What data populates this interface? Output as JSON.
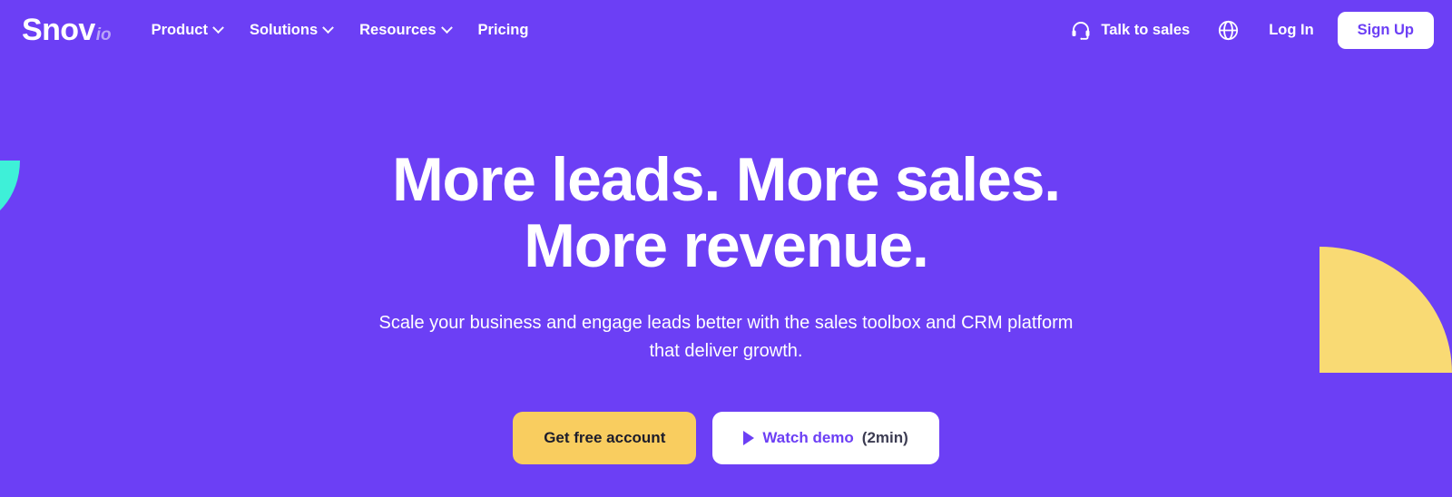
{
  "brand": {
    "name": "Snov",
    "tld": "io",
    "purple": "#6c3ff5",
    "yellow": "#f9cd5f",
    "teal": "#3ef0d8",
    "white": "#ffffff"
  },
  "header": {
    "nav": [
      {
        "label": "Product",
        "has_dropdown": true,
        "icon": "chevron-down-icon"
      },
      {
        "label": "Solutions",
        "has_dropdown": true,
        "icon": "chevron-down-icon"
      },
      {
        "label": "Resources",
        "has_dropdown": true,
        "icon": "chevron-down-icon"
      },
      {
        "label": "Pricing",
        "has_dropdown": false,
        "icon": ""
      }
    ],
    "talk_to_sales": {
      "label": "Talk to sales",
      "icon": "headset-icon"
    },
    "language": {
      "icon": "globe-icon"
    },
    "login_label": "Log In",
    "signup_label": "Sign Up"
  },
  "hero": {
    "title_line1": "More leads. More sales.",
    "title_line2": "More revenue.",
    "subtitle_line1": "Scale your business and engage leads better with the sales toolbox and CRM platform",
    "subtitle_line2": "that deliver growth.",
    "primary_cta": "Get free account",
    "secondary_cta": "Watch demo",
    "secondary_cta_duration": "(2min)",
    "secondary_cta_icon": "play-icon"
  },
  "decorations": {
    "left_shape": "teal-quarter-circle",
    "right_shape": "yellow-quarter-circle"
  }
}
